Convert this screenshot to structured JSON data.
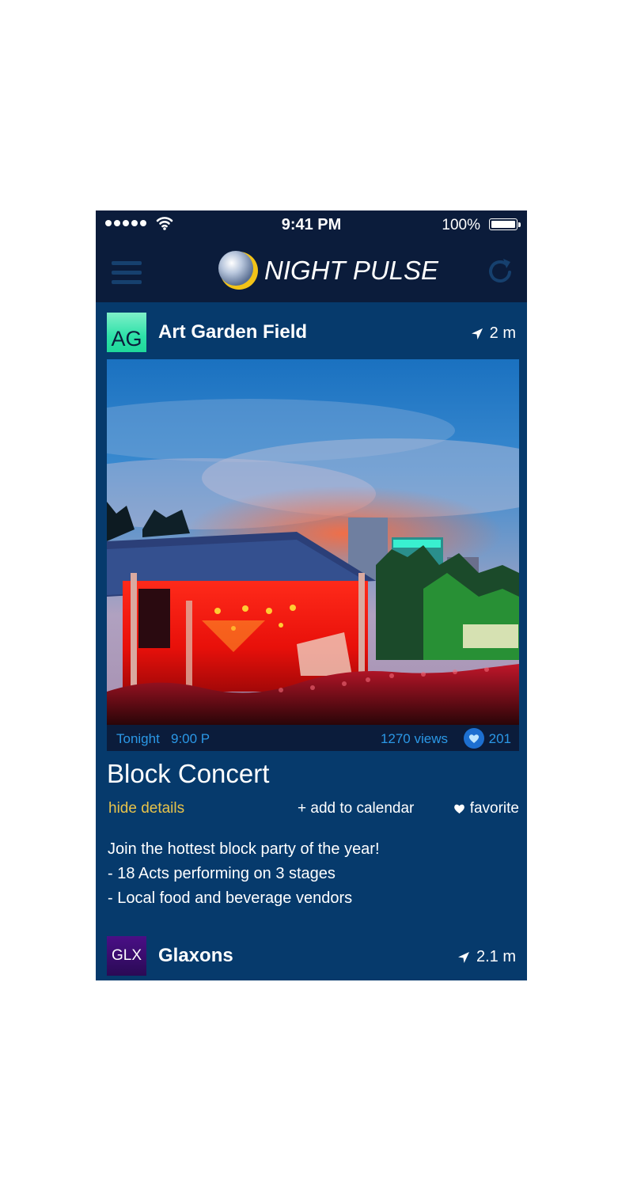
{
  "status_bar": {
    "time": "9:41 PM",
    "battery": "100%",
    "signal_icon": "signal-dots-icon",
    "wifi_icon": "wifi-icon",
    "battery_icon": "battery-icon"
  },
  "nav": {
    "app_name": "NIGHT PULSE",
    "menu_icon": "hamburger-menu-icon",
    "refresh_icon": "refresh-icon"
  },
  "venues": [
    {
      "initials": "AG",
      "name": "Art Garden Field",
      "distance": "2 m",
      "avatar_colors": [
        "#2de1a8",
        "#7ef0c9"
      ],
      "event": {
        "time_label": "Tonight",
        "time": "9:00 P",
        "views": "1270 views",
        "likes": "201",
        "title": "Block Concert",
        "hide_details": "hide details",
        "add_to_calendar": "+ add to calendar",
        "favorite": "favorite",
        "description": [
          "Join the hottest block party of the year!",
          "- 18 Acts performing on 3 stages",
          "- Local food and beverage vendors"
        ]
      }
    },
    {
      "initials": "GLX",
      "name": "Glaxons",
      "distance": "2.1 m",
      "avatar_colors": [
        "#4a0f86",
        "#2a0a55"
      ]
    }
  ],
  "colors": {
    "background": "#063a6c",
    "navbar": "#0b1c3b",
    "accent_blue": "#2b98e6",
    "hide_details": "#e8c34a"
  }
}
